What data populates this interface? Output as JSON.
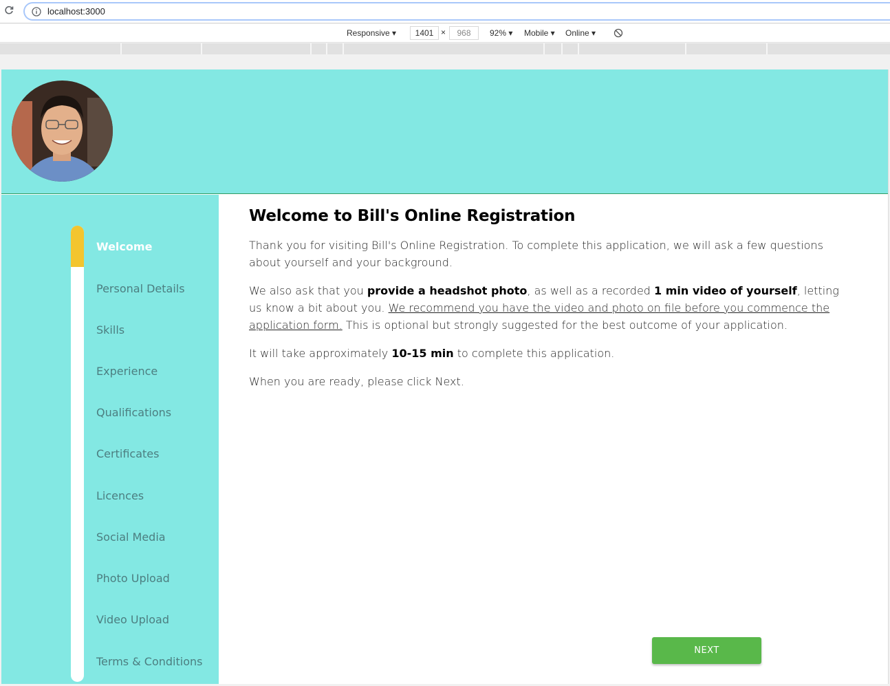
{
  "browser": {
    "url": "localhost:3000"
  },
  "device_toolbar": {
    "device": "Responsive ▾",
    "width": "1401",
    "height": "968",
    "times": "×",
    "zoom": "92% ▾",
    "throttle_mode": "Mobile ▾",
    "network": "Online ▾"
  },
  "nav": {
    "items": [
      {
        "label": "Welcome",
        "active": true
      },
      {
        "label": "Personal Details"
      },
      {
        "label": "Skills"
      },
      {
        "label": "Experience"
      },
      {
        "label": "Qualifications"
      },
      {
        "label": "Certificates"
      },
      {
        "label": "Licences"
      },
      {
        "label": "Social Media"
      },
      {
        "label": "Photo Upload"
      },
      {
        "label": "Video Upload"
      },
      {
        "label": "Terms & Conditions"
      }
    ],
    "progress_fraction": 0.09
  },
  "main": {
    "title": "Welcome to Bill's Online Registration",
    "p1": "Thank you for visiting Bill's Online Registration. To complete this application, we will ask a few questions about yourself and your background.",
    "p2_a": "We also ask that you ",
    "p2_b": "provide a headshot photo",
    "p2_c": ", as well as a recorded ",
    "p2_d": "1 min video of yourself",
    "p2_e": ", letting us know a bit about you.  ",
    "p2_f": "We recommend you have the video and photo on file before you commence the application form.",
    "p2_g": " This is optional but strongly suggested for the best outcome of your application.",
    "p3_a": "It will take approximately ",
    "p3_b": "10-15 min",
    "p3_c": " to complete this application.",
    "p4": "When you are ready, please click Next.",
    "next_label": "NEXT"
  },
  "colors": {
    "header_bg": "#83e8e3",
    "progress_fill": "#f3c52f",
    "next_button": "#59b84a"
  }
}
